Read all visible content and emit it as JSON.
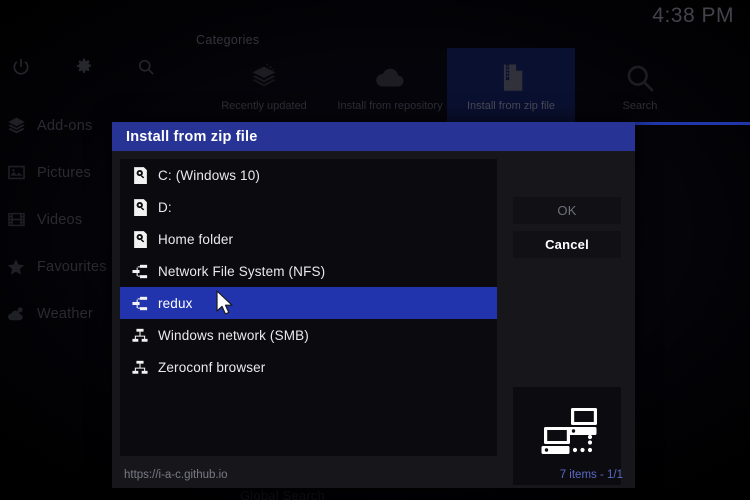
{
  "statusbar": {
    "clock": "4:38 PM"
  },
  "top_actions": [
    {
      "name": "power-icon",
      "label": "Power"
    },
    {
      "name": "gear-icon",
      "label": "Settings"
    },
    {
      "name": "search-icon",
      "label": "Search"
    }
  ],
  "sidebar": {
    "items": [
      {
        "label": "Add-ons",
        "icon": "layers-icon"
      },
      {
        "label": "Pictures",
        "icon": "picture-icon"
      },
      {
        "label": "Videos",
        "icon": "film-icon"
      },
      {
        "label": "Favourites",
        "icon": "star-icon"
      },
      {
        "label": "Weather",
        "icon": "cloud-sun-icon"
      }
    ]
  },
  "categories": {
    "heading": "Categories",
    "tabs": [
      {
        "label": "Recently updated",
        "icon": "open-box-icon",
        "selected": false
      },
      {
        "label": "Install from repository",
        "icon": "cloud-down-icon",
        "selected": false
      },
      {
        "label": "Install from zip file",
        "icon": "zip-down-icon",
        "selected": true
      },
      {
        "label": "Search",
        "icon": "search-icon",
        "selected": false
      }
    ]
  },
  "background_text": {
    "ghost_label": "Global Search"
  },
  "dialog": {
    "title": "Install from zip file",
    "list": [
      {
        "label": "C: (Windows 10)",
        "icon": "hard-drive-icon",
        "selected": false
      },
      {
        "label": "D:",
        "icon": "hard-drive-icon",
        "selected": false
      },
      {
        "label": "Home folder",
        "icon": "hard-drive-icon",
        "selected": false
      },
      {
        "label": "Network File System (NFS)",
        "icon": "network-icon",
        "selected": false
      },
      {
        "label": "redux",
        "icon": "network-icon",
        "selected": true
      },
      {
        "label": "Windows network (SMB)",
        "icon": "network-alt-icon",
        "selected": false
      },
      {
        "label": "Zeroconf browser",
        "icon": "network-alt-icon",
        "selected": false
      }
    ],
    "buttons": {
      "ok": "OK",
      "cancel": "Cancel"
    },
    "preview_icon": "network-computers-icon",
    "footer": {
      "url": "https://i-a-c.github.io",
      "count": "7 items - 1/1"
    }
  },
  "colors": {
    "title_bar": "#273495",
    "selection": "#2234ad",
    "nav_underline": "#2136a8",
    "tab_selected_bg": "#0a1030",
    "dialog_bg": "#16161b",
    "list_bg": "#0b0b0f",
    "footer_count": "#5a6bc4"
  }
}
